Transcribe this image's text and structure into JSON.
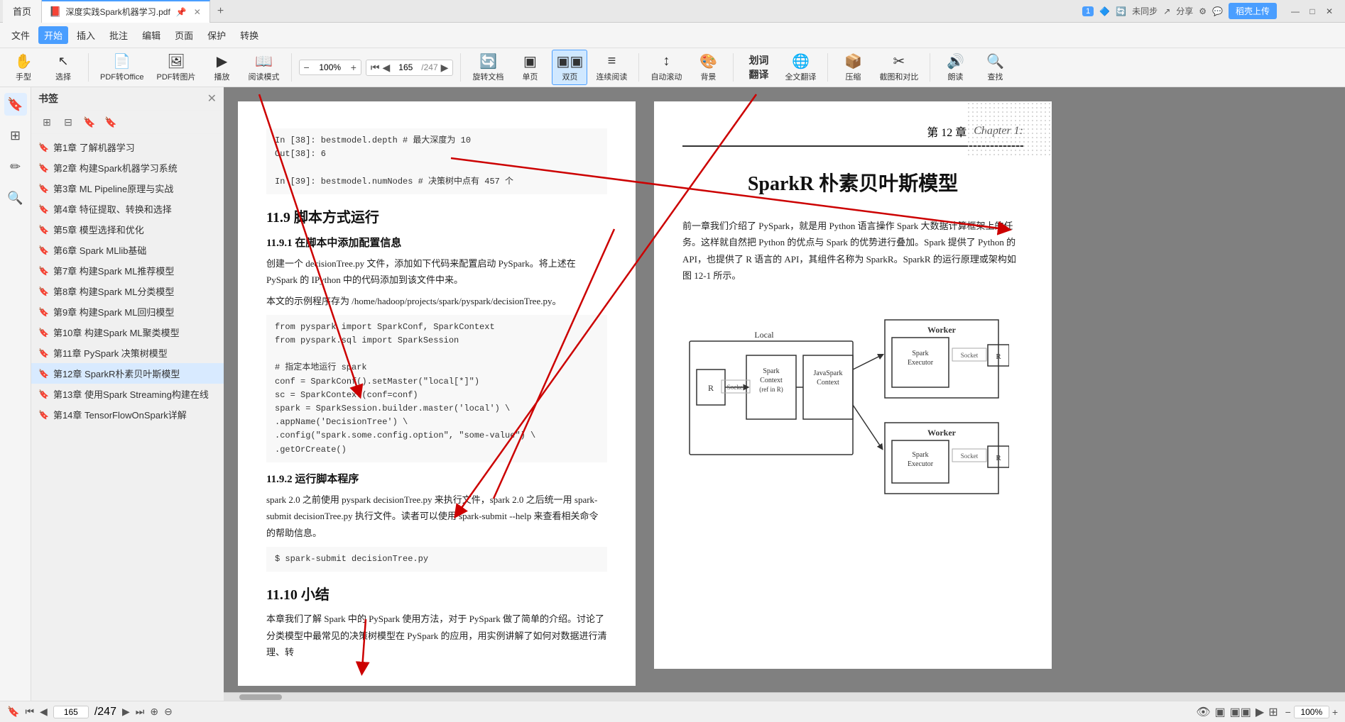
{
  "tabs": {
    "home_label": "首页",
    "pdf_tab_label": "深度实践Spark机器学习.pdf",
    "add_tab": "+",
    "badge": "1",
    "upload_btn": "稻壳上传",
    "sync": "未同步",
    "share": "分享",
    "win_min": "—",
    "win_max": "□",
    "win_close": "✕"
  },
  "toolbar": {
    "menus": [
      "文件",
      "开始",
      "插入",
      "批注",
      "编辑",
      "页面",
      "保护",
      "转换"
    ],
    "active_menu": "开始",
    "tools_row1": [
      {
        "name": "手型",
        "icon": "✋"
      },
      {
        "name": "选择",
        "icon": "↖"
      },
      {
        "name": "PDF转Office",
        "icon": "📄"
      },
      {
        "name": "PDF转图片",
        "icon": "🖼"
      },
      {
        "name": "播放",
        "icon": "▶"
      },
      {
        "name": "阅读模式",
        "icon": "📖"
      }
    ],
    "zoom": "100%",
    "zoom_in": "+",
    "zoom_out": "−",
    "page_current": "165",
    "page_total": "247",
    "tools_row2": [
      {
        "name": "旋转文档",
        "icon": "🔄"
      },
      {
        "name": "单页",
        "icon": "▣"
      },
      {
        "name": "双页",
        "icon": "▣▣",
        "active": true
      },
      {
        "name": "连续阅读",
        "icon": "≡"
      },
      {
        "name": "自动滚动",
        "icon": "↕"
      },
      {
        "name": "背景",
        "icon": "🎨"
      },
      {
        "name": "划词翻译",
        "icon": "T"
      },
      {
        "name": "全文翻译",
        "icon": "🌐"
      },
      {
        "name": "压缩",
        "icon": "📦"
      },
      {
        "name": "截图和对比",
        "icon": "✂"
      },
      {
        "name": "朗读",
        "icon": "🔊"
      },
      {
        "name": "查找",
        "icon": "🔍"
      }
    ]
  },
  "sidebar": {
    "title": "书签",
    "items": [
      {
        "label": "第1章  了解机器学习"
      },
      {
        "label": "第2章  构建Spark机器学习系统"
      },
      {
        "label": "第3章  ML Pipeline原理与实战"
      },
      {
        "label": "第4章  特征提取、转换和选择"
      },
      {
        "label": "第5章  模型选择和优化"
      },
      {
        "label": "第6章  Spark MLlib基础"
      },
      {
        "label": "第7章  构建Spark ML推荐模型"
      },
      {
        "label": "第8章  构建Spark ML分类模型"
      },
      {
        "label": "第9章  构建Spark ML回归模型"
      },
      {
        "label": "第10章  构建Spark ML聚类模型"
      },
      {
        "label": "第11章  PySpark 决策树模型"
      },
      {
        "label": "第12章  SparkR朴素贝叶斯模型",
        "active": true
      },
      {
        "label": "第13章  使用Spark Streaming构建在线"
      },
      {
        "label": "第14章  TensorFlowOnSpark详解"
      }
    ]
  },
  "left_page": {
    "code1": {
      "line1": "In [38]: bestmodel.depth  # 最大深度为 10",
      "line2": "Out[38]: 6",
      "line3": "",
      "line4": "In [39]: bestmodel.numNodes  # 决策树中点有 457 个"
    },
    "section_11_9": "11.9  脚本方式运行",
    "subsection_11_9_1": "11.9.1  在脚本中添加配置信息",
    "text_11_9_1": "创建一个 decisionTree.py 文件，添加如下代码来配置启动 PySpark。将上述在 PySpark 的 IPython 中的代码添加到该文件中来。",
    "text_11_9_1b": "本文的示例程序存为 /home/hadoop/projects/spark/pyspark/decisionTree.py。",
    "code2": {
      "l1": "from pyspark import SparkConf, SparkContext",
      "l2": "from pyspark.sql import SparkSession",
      "l3": "",
      "l4": "# 指定本地运行 spark",
      "l5": "conf = SparkConf().setMaster(\"local[*]\")",
      "l6": "sc = SparkContext(conf=conf)",
      "l7": "spark = SparkSession.builder.master('local') \\",
      "l8": "        .appName('DecisionTree') \\",
      "l9": "        .config(\"spark.some.config.option\", \"some-value\") \\",
      "l10": "        .getOrCreate()"
    },
    "subsection_11_9_2": "11.9.2  运行脚本程序",
    "text_11_9_2": "spark 2.0 之前使用 pyspark decisionTree.py 来执行文件，spark 2.0 之后统一用 spark-submit decisionTree.py 执行文件。读者可以使用 spark-submit --help 来查看相关命令的帮助信息。",
    "code3": "$ spark-submit decisionTree.py",
    "section_11_10": "11.10  小结",
    "text_11_10": "本章我们了解 Spark 中的 PySpark 使用方法，对于 PySpark 做了简单的介绍。讨论了分类模型中最常见的决策树模型在 PySpark 的应用，用实例讲解了如何对数据进行清理、转"
  },
  "right_page": {
    "chapter_num": "第 12 章",
    "chapter_italic": "Chapter 1:",
    "chapter_title": "SparkR 朴素贝叶斯模型",
    "text_intro": "前一章我们介绍了 PySpark，就是用 Python 语言操作 Spark 大数据计算框架上的任务。这样就自然把 Python 的优点与 Spark 的优势进行叠加。Spark 提供了 Python 的 API，也提供了 R 语言的 API，其组件名称为 SparkR。SparkR 的运行原理或架构如图 12-1 所示。",
    "diagram_label_local": "Local",
    "diagram_label_r1": "R",
    "diagram_label_sparkcontext": "Spark\nContext\n(ref in R)",
    "diagram_label_socket1": "Socket",
    "diagram_label_javaspark": "JavaSpark\nContext",
    "diagram_label_worker1": "Worker",
    "diagram_label_executor1": "Spark\nExecutor",
    "diagram_label_socket2": "Socket",
    "diagram_label_r2": "R",
    "diagram_label_worker2": "Worker",
    "diagram_label_executor2": "Spark\nExecutor",
    "diagram_label_socket3": "Socket",
    "diagram_label_r3": "R"
  },
  "status_bar": {
    "page_current": "165",
    "page_total": "247",
    "zoom": "100%"
  }
}
